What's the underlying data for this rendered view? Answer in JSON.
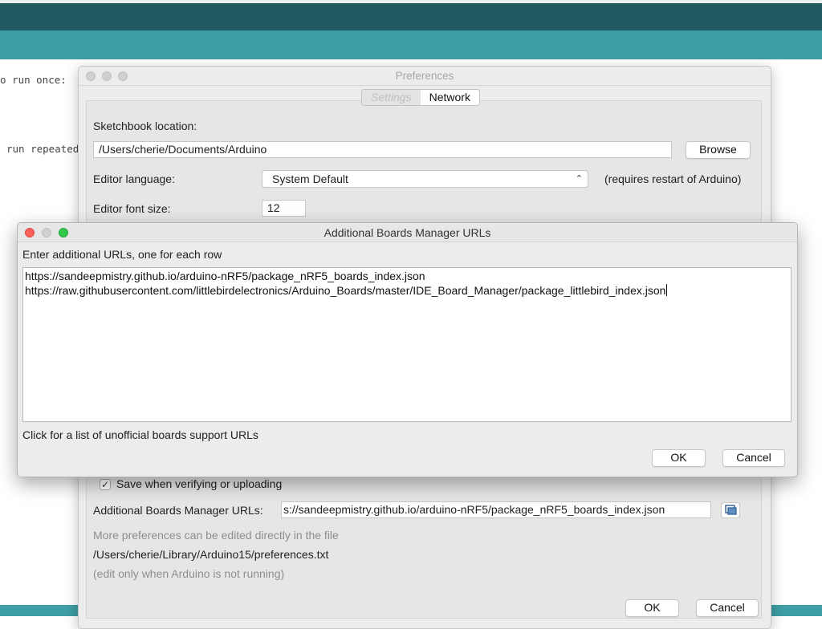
{
  "ide": {
    "code_lines": [
      "o run once:",
      "run repeated"
    ]
  },
  "preferences": {
    "title": "Preferences",
    "tabs": [
      {
        "label": "Settings",
        "active": false
      },
      {
        "label": "Network",
        "active": true
      }
    ],
    "sketchbook_label": "Sketchbook location:",
    "sketchbook_value": "/Users/cherie/Documents/Arduino",
    "browse_label": "Browse",
    "language_label": "Editor language:",
    "language_value": "System Default",
    "language_note": "(requires restart of Arduino)",
    "font_size_label": "Editor font size:",
    "font_size_value": "12",
    "save_checkbox_label": "Save when verifying or uploading",
    "save_checked": true,
    "boards_urls_label": "Additional Boards Manager URLs:",
    "boards_urls_value": "s://sandeepmistry.github.io/arduino-nRF5/package_nRF5_boards_index.json",
    "more_prefs_note": "More preferences can be edited directly in the file",
    "prefs_path": "/Users/cherie/Library/Arduino15/preferences.txt",
    "edit_note": "(edit only when Arduino is not running)",
    "ok_label": "OK",
    "cancel_label": "Cancel"
  },
  "urls_dialog": {
    "title": "Additional Boards Manager URLs",
    "instruction": "Enter additional URLs, one for each row",
    "urls": [
      "https://sandeepmistry.github.io/arduino-nRF5/package_nRF5_boards_index.json",
      "https://raw.githubusercontent.com/littlebirdelectronics/Arduino_Boards/master/IDE_Board_Manager/package_littlebird_index.json"
    ],
    "unofficial_link": "Click for a list of unofficial boards support URLs",
    "ok_label": "OK",
    "cancel_label": "Cancel"
  },
  "colors": {
    "ide_dark_teal": "#1f5a60",
    "ide_teal": "#3e9ea5",
    "close_red": "#fc605b",
    "zoom_green": "#34c84a"
  }
}
